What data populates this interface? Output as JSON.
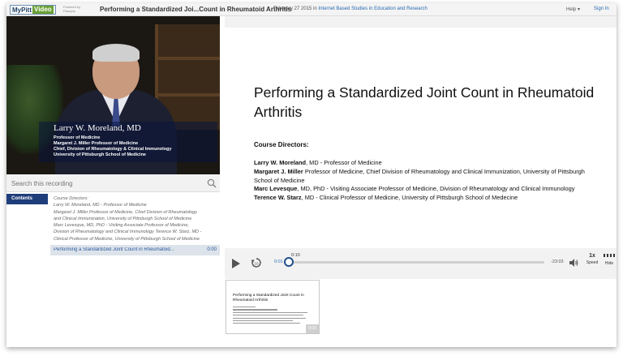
{
  "header": {
    "logo_my": "My",
    "logo_pitt": "Pitt",
    "logo_video": "Video",
    "powered_by": "Powered by Panopto",
    "recording_title": "Performing a Standardized Joi...Count in Rheumatoid Arthritis",
    "date": "February 27 2015",
    "date_in": "in",
    "folder": "Internet Based Studies in Education and Research",
    "help_label": "Help ▾",
    "signin_label": "Sign In"
  },
  "video": {
    "lower_third": {
      "name": "Larry W. Moreland, MD",
      "lines": [
        "Professor of Medicine",
        "Margaret J. Miller Professor of Medicine",
        "Chief, Division of Rheumatology & Clinical Immunology",
        "University of Pittsburgh School of Medicine"
      ]
    }
  },
  "search": {
    "placeholder": "Search this recording"
  },
  "contents": {
    "tab_label": "Contents",
    "description_lines": [
      "Course Directors:",
      "Larry W. Moreland, MD - Professor of Medicine",
      "Margaret J. Miller Professor of Medicine, Chief Division of Rheumatology",
      "and Clinical Immunization, University of Pittsburgh School of Medicine",
      "Marc Levesque, MD, PhD - Visiting Associate Professor of Medicine,",
      "Division of Rheumatology and Clinical Immunology Terence W. Starz, MD -",
      "Clinical Professor of Medicine, University of Pittsburgh School of Medicine"
    ],
    "item": {
      "title": "Performing a Standardized Joint Count in Rheumatoid...",
      "time": "0:00"
    }
  },
  "slide": {
    "title": "Performing a Standardized Joint Count in Rheumatoid Arthritis",
    "heading": "Course Directors:",
    "entries": [
      {
        "name": "Larry W. Moreland",
        "rest": ", MD - Professor of Medicine"
      },
      {
        "name": "Margaret J. Miller",
        "rest": " Professor of Medicine, Chief Division of Rheumatology and Clinical Immunization, University of Pittsburgh School of Medicine"
      },
      {
        "name": "Marc Levesque",
        "rest": ", MD, PhD - Visiting Associate Professor of Medicine, Division of Rheumatology and Clinical Immunology"
      },
      {
        "name": "Terence W. Starz",
        "rest": ", MD - Clinical Professor of Medicine, University of Pittsburgh School of Medecine"
      }
    ]
  },
  "player": {
    "current_time": "0:01",
    "marker_time": "0:10",
    "remaining_time": "-23:03",
    "speed_value": "1x",
    "speed_label": "Speed",
    "hide_label": "Hide",
    "icons": {
      "play": "play-icon",
      "rewind": "rewind-icon",
      "volume": "volume-icon",
      "hide": "hide-icon"
    }
  },
  "thumbnail": {
    "title": "Performing a Standardized Joint Count in Rheumatoid Arthritis",
    "time": "0:00"
  },
  "colors": {
    "accent": "#1f3d7a",
    "link": "#2a6ab0",
    "logo_green": "#6aa037"
  }
}
